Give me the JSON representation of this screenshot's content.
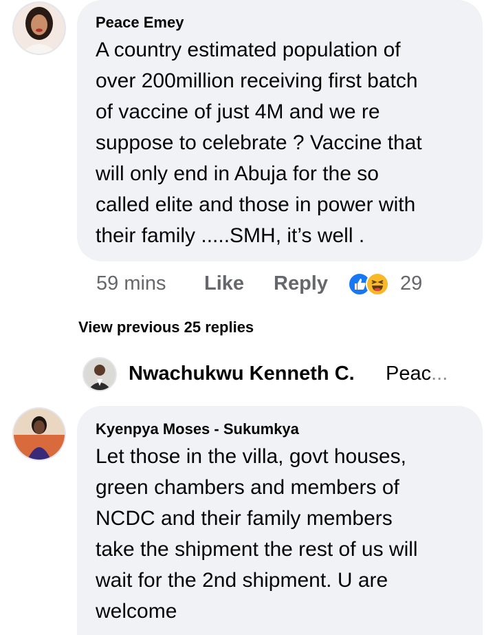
{
  "comments": [
    {
      "author": "Peace Emey",
      "lines": [
        "A country estimated population of",
        "over 200million receiving first batch",
        "of vaccine of just 4M and we re",
        "suppose to celebrate ? Vaccine that",
        "will only end in Abuja for the so",
        "called elite and those in power with",
        "their family .....SMH, it’s well ."
      ],
      "time": "59 mins",
      "like_label": "Like",
      "reply_label": "Reply",
      "reaction_count": "29",
      "reactions": [
        "like-icon",
        "haha-icon"
      ]
    },
    {
      "author": "Kyenpya Moses - Sukumkya",
      "lines": [
        "Let those in the villa, govt houses,",
        "green chambers and members of",
        "NCDC and their family members",
        "take the shipment the rest of us will",
        "wait for the 2nd shipment. U are",
        "welcome"
      ]
    }
  ],
  "view_previous": "View previous 25 replies",
  "reply_preview": {
    "author": "Nwachukwu Kenneth C.",
    "text": "Peac",
    "ellipsis": "..."
  },
  "colors": {
    "bubble": "#f0f2f5",
    "secondary_text": "#65676b",
    "like_blue": "#1877f2",
    "haha_yellow": "#f7b928"
  }
}
